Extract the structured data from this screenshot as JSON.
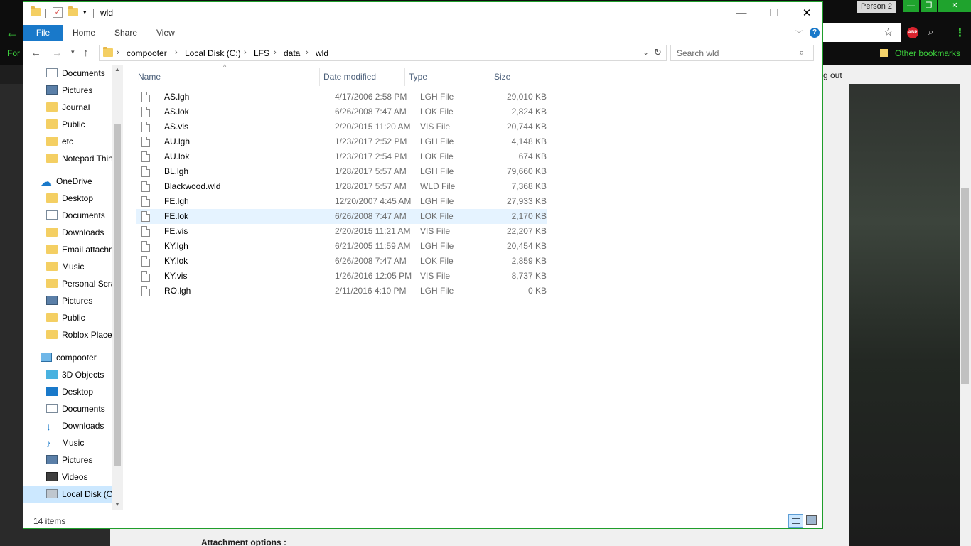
{
  "browser": {
    "person": "Person 2",
    "back_label": "For",
    "bookmarks_label": "Other bookmarks",
    "abp_label": "ABP",
    "page_text_logout": "g out",
    "page_text_attach": "Attachment options :"
  },
  "window": {
    "title": "wld",
    "controls": {
      "minimize": "—",
      "maximize": "☐",
      "close": "✕"
    }
  },
  "ribbon": {
    "tabs": [
      "File",
      "Home",
      "Share",
      "View"
    ],
    "help": "?"
  },
  "address": {
    "crumbs": [
      "compooter",
      "Local Disk (C:)",
      "LFS",
      "data",
      "wld"
    ],
    "search_placeholder": "Search wld"
  },
  "navpane": {
    "items": [
      {
        "label": "Documents",
        "icon": "documents-icon",
        "pinned": true
      },
      {
        "label": "Pictures",
        "icon": "pictures-icon",
        "pinned": true
      },
      {
        "label": "Journal",
        "icon": "folder-icon",
        "pinned": true
      },
      {
        "label": "Public",
        "icon": "folder-icon",
        "pinned": true
      },
      {
        "label": "etc",
        "icon": "folder-icon",
        "pinned": false
      },
      {
        "label": "Notepad Thin",
        "icon": "folder-icon",
        "pinned": false
      },
      {
        "label": "OneDrive",
        "icon": "onedrive-icon",
        "pinned": false
      },
      {
        "label": "Desktop",
        "icon": "folder-icon",
        "pinned": false
      },
      {
        "label": "Documents",
        "icon": "documents-icon",
        "pinned": false
      },
      {
        "label": "Downloads",
        "icon": "folder-icon",
        "pinned": false
      },
      {
        "label": "Email attachn",
        "icon": "folder-icon",
        "pinned": false
      },
      {
        "label": "Music",
        "icon": "folder-icon",
        "pinned": false
      },
      {
        "label": "Personal Scra",
        "icon": "folder-icon",
        "pinned": false
      },
      {
        "label": "Pictures",
        "icon": "pictures-icon",
        "pinned": false
      },
      {
        "label": "Public",
        "icon": "folder-icon",
        "pinned": false
      },
      {
        "label": "Roblox Places",
        "icon": "folder-icon",
        "pinned": false
      },
      {
        "label": "compooter",
        "icon": "this-pc-icon",
        "pinned": false
      },
      {
        "label": "3D Objects",
        "icon": "3d-objects-icon",
        "pinned": false
      },
      {
        "label": "Desktop",
        "icon": "desktop-icon",
        "pinned": false
      },
      {
        "label": "Documents",
        "icon": "documents-icon",
        "pinned": false
      },
      {
        "label": "Downloads",
        "icon": "downloads-icon",
        "pinned": false
      },
      {
        "label": "Music",
        "icon": "music-icon",
        "pinned": false
      },
      {
        "label": "Pictures",
        "icon": "pictures-icon",
        "pinned": false
      },
      {
        "label": "Videos",
        "icon": "videos-icon",
        "pinned": false
      },
      {
        "label": "Local Disk (C:",
        "icon": "local-disk-icon",
        "pinned": false
      }
    ]
  },
  "columns": {
    "name": "Name",
    "date": "Date modified",
    "type": "Type",
    "size": "Size"
  },
  "files": [
    {
      "name": "AS.lgh",
      "date": "4/17/2006 2:58 PM",
      "type": "LGH File",
      "size": "29,010 KB"
    },
    {
      "name": "AS.lok",
      "date": "6/26/2008 7:47 AM",
      "type": "LOK File",
      "size": "2,824 KB"
    },
    {
      "name": "AS.vis",
      "date": "2/20/2015 11:20 AM",
      "type": "VIS File",
      "size": "20,744 KB"
    },
    {
      "name": "AU.lgh",
      "date": "1/23/2017 2:52 PM",
      "type": "LGH File",
      "size": "4,148 KB"
    },
    {
      "name": "AU.lok",
      "date": "1/23/2017 2:54 PM",
      "type": "LOK File",
      "size": "674 KB"
    },
    {
      "name": "BL.lgh",
      "date": "1/28/2017 5:57 AM",
      "type": "LGH File",
      "size": "79,660 KB"
    },
    {
      "name": "Blackwood.wld",
      "date": "1/28/2017 5:57 AM",
      "type": "WLD File",
      "size": "7,368 KB"
    },
    {
      "name": "FE.lgh",
      "date": "12/20/2007 4:45 AM",
      "type": "LGH File",
      "size": "27,933 KB"
    },
    {
      "name": "FE.lok",
      "date": "6/26/2008 7:47 AM",
      "type": "LOK File",
      "size": "2,170 KB"
    },
    {
      "name": "FE.vis",
      "date": "2/20/2015 11:21 AM",
      "type": "VIS File",
      "size": "22,207 KB"
    },
    {
      "name": "KY.lgh",
      "date": "6/21/2005 11:59 AM",
      "type": "LGH File",
      "size": "20,454 KB"
    },
    {
      "name": "KY.lok",
      "date": "6/26/2008 7:47 AM",
      "type": "LOK File",
      "size": "2,859 KB"
    },
    {
      "name": "KY.vis",
      "date": "1/26/2016 12:05 PM",
      "type": "VIS File",
      "size": "8,737 KB"
    },
    {
      "name": "RO.lgh",
      "date": "2/11/2016 4:10 PM",
      "type": "LGH File",
      "size": "0 KB"
    }
  ],
  "status": {
    "count": "14 items"
  },
  "colors": {
    "accent": "#1979ca",
    "selection": "#cce8ff",
    "hover_row": "#e5f3ff",
    "window_border": "#1f9e2b"
  }
}
